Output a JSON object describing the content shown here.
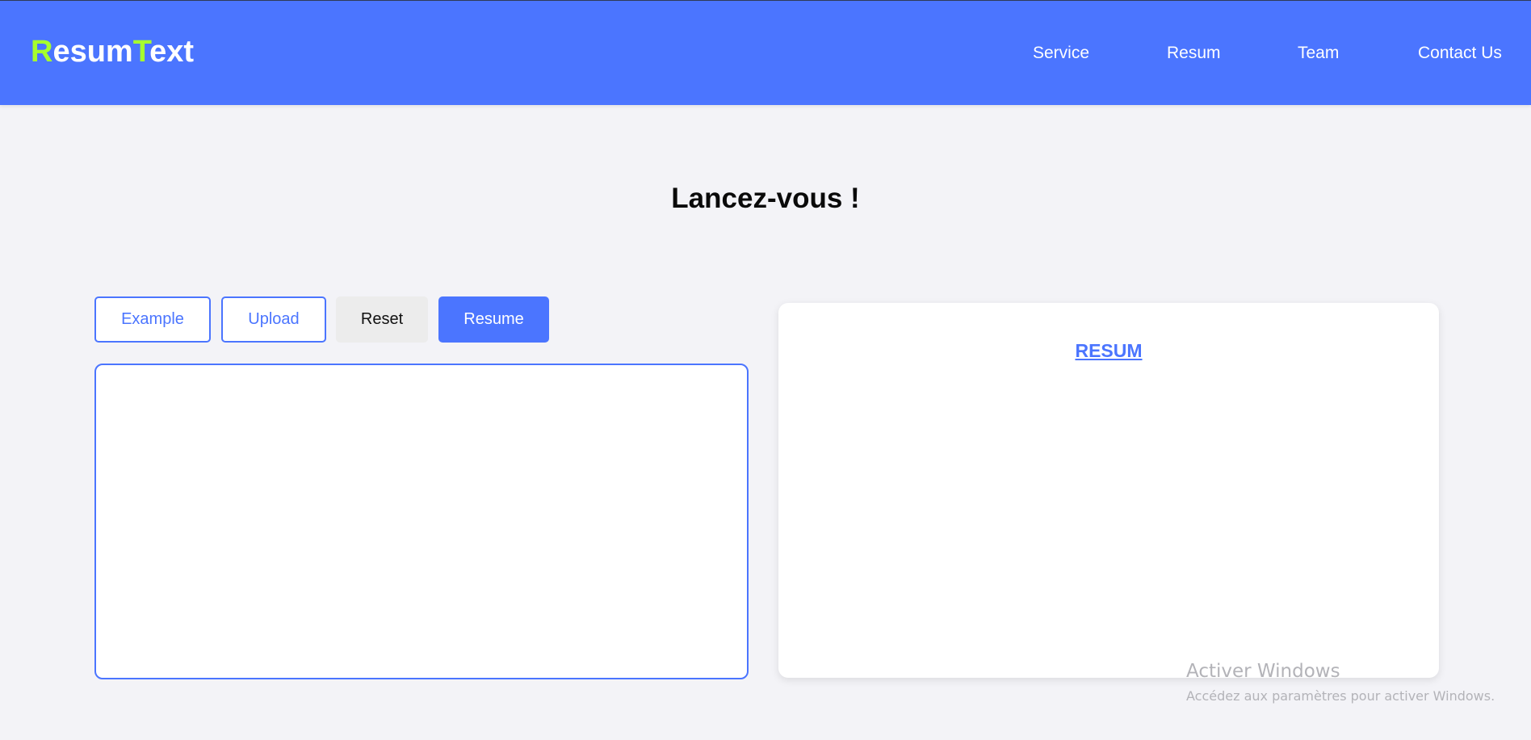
{
  "header": {
    "logo": {
      "part1_accent": "R",
      "part1_rest": "esum",
      "part2_accent": "T",
      "part2_rest": "ext"
    },
    "nav": [
      "Service",
      "Resum",
      "Team",
      "Contact Us"
    ]
  },
  "main": {
    "title": "Lancez-vous !",
    "buttons": {
      "example": "Example",
      "upload": "Upload",
      "reset": "Reset",
      "resume": "Resume"
    },
    "input": {
      "value": "",
      "placeholder": ""
    },
    "result": {
      "link_label": "RESUM"
    }
  },
  "watermark": {
    "title": "Activer Windows",
    "subtitle": "Accédez aux paramètres pour activer Windows."
  },
  "colors": {
    "primary": "#4b75ff",
    "logo_accent": "#a6ff2e",
    "background": "#f3f3f7"
  }
}
